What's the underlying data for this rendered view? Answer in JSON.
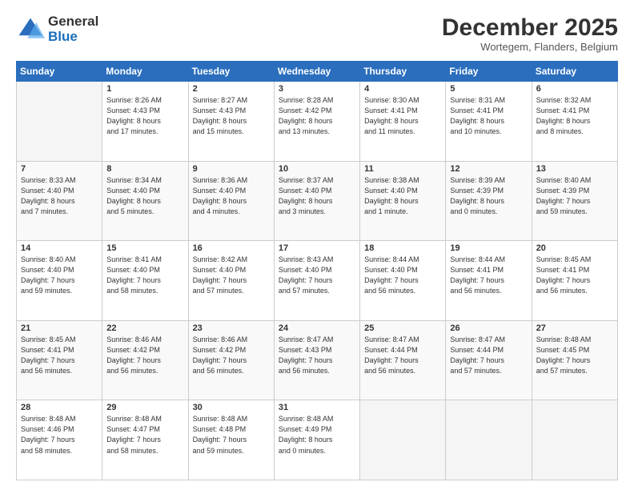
{
  "logo": {
    "line1": "General",
    "line2": "Blue"
  },
  "title": "December 2025",
  "subtitle": "Wortegem, Flanders, Belgium",
  "weekdays": [
    "Sunday",
    "Monday",
    "Tuesday",
    "Wednesday",
    "Thursday",
    "Friday",
    "Saturday"
  ],
  "weeks": [
    [
      {
        "day": "",
        "info": ""
      },
      {
        "day": "1",
        "info": "Sunrise: 8:26 AM\nSunset: 4:43 PM\nDaylight: 8 hours\nand 17 minutes."
      },
      {
        "day": "2",
        "info": "Sunrise: 8:27 AM\nSunset: 4:43 PM\nDaylight: 8 hours\nand 15 minutes."
      },
      {
        "day": "3",
        "info": "Sunrise: 8:28 AM\nSunset: 4:42 PM\nDaylight: 8 hours\nand 13 minutes."
      },
      {
        "day": "4",
        "info": "Sunrise: 8:30 AM\nSunset: 4:41 PM\nDaylight: 8 hours\nand 11 minutes."
      },
      {
        "day": "5",
        "info": "Sunrise: 8:31 AM\nSunset: 4:41 PM\nDaylight: 8 hours\nand 10 minutes."
      },
      {
        "day": "6",
        "info": "Sunrise: 8:32 AM\nSunset: 4:41 PM\nDaylight: 8 hours\nand 8 minutes."
      }
    ],
    [
      {
        "day": "7",
        "info": "Sunrise: 8:33 AM\nSunset: 4:40 PM\nDaylight: 8 hours\nand 7 minutes."
      },
      {
        "day": "8",
        "info": "Sunrise: 8:34 AM\nSunset: 4:40 PM\nDaylight: 8 hours\nand 5 minutes."
      },
      {
        "day": "9",
        "info": "Sunrise: 8:36 AM\nSunset: 4:40 PM\nDaylight: 8 hours\nand 4 minutes."
      },
      {
        "day": "10",
        "info": "Sunrise: 8:37 AM\nSunset: 4:40 PM\nDaylight: 8 hours\nand 3 minutes."
      },
      {
        "day": "11",
        "info": "Sunrise: 8:38 AM\nSunset: 4:40 PM\nDaylight: 8 hours\nand 1 minute."
      },
      {
        "day": "12",
        "info": "Sunrise: 8:39 AM\nSunset: 4:39 PM\nDaylight: 8 hours\nand 0 minutes."
      },
      {
        "day": "13",
        "info": "Sunrise: 8:40 AM\nSunset: 4:39 PM\nDaylight: 7 hours\nand 59 minutes."
      }
    ],
    [
      {
        "day": "14",
        "info": "Sunrise: 8:40 AM\nSunset: 4:40 PM\nDaylight: 7 hours\nand 59 minutes."
      },
      {
        "day": "15",
        "info": "Sunrise: 8:41 AM\nSunset: 4:40 PM\nDaylight: 7 hours\nand 58 minutes."
      },
      {
        "day": "16",
        "info": "Sunrise: 8:42 AM\nSunset: 4:40 PM\nDaylight: 7 hours\nand 57 minutes."
      },
      {
        "day": "17",
        "info": "Sunrise: 8:43 AM\nSunset: 4:40 PM\nDaylight: 7 hours\nand 57 minutes."
      },
      {
        "day": "18",
        "info": "Sunrise: 8:44 AM\nSunset: 4:40 PM\nDaylight: 7 hours\nand 56 minutes."
      },
      {
        "day": "19",
        "info": "Sunrise: 8:44 AM\nSunset: 4:41 PM\nDaylight: 7 hours\nand 56 minutes."
      },
      {
        "day": "20",
        "info": "Sunrise: 8:45 AM\nSunset: 4:41 PM\nDaylight: 7 hours\nand 56 minutes."
      }
    ],
    [
      {
        "day": "21",
        "info": "Sunrise: 8:45 AM\nSunset: 4:41 PM\nDaylight: 7 hours\nand 56 minutes."
      },
      {
        "day": "22",
        "info": "Sunrise: 8:46 AM\nSunset: 4:42 PM\nDaylight: 7 hours\nand 56 minutes."
      },
      {
        "day": "23",
        "info": "Sunrise: 8:46 AM\nSunset: 4:42 PM\nDaylight: 7 hours\nand 56 minutes."
      },
      {
        "day": "24",
        "info": "Sunrise: 8:47 AM\nSunset: 4:43 PM\nDaylight: 7 hours\nand 56 minutes."
      },
      {
        "day": "25",
        "info": "Sunrise: 8:47 AM\nSunset: 4:44 PM\nDaylight: 7 hours\nand 56 minutes."
      },
      {
        "day": "26",
        "info": "Sunrise: 8:47 AM\nSunset: 4:44 PM\nDaylight: 7 hours\nand 57 minutes."
      },
      {
        "day": "27",
        "info": "Sunrise: 8:48 AM\nSunset: 4:45 PM\nDaylight: 7 hours\nand 57 minutes."
      }
    ],
    [
      {
        "day": "28",
        "info": "Sunrise: 8:48 AM\nSunset: 4:46 PM\nDaylight: 7 hours\nand 58 minutes."
      },
      {
        "day": "29",
        "info": "Sunrise: 8:48 AM\nSunset: 4:47 PM\nDaylight: 7 hours\nand 58 minutes."
      },
      {
        "day": "30",
        "info": "Sunrise: 8:48 AM\nSunset: 4:48 PM\nDaylight: 7 hours\nand 59 minutes."
      },
      {
        "day": "31",
        "info": "Sunrise: 8:48 AM\nSunset: 4:49 PM\nDaylight: 8 hours\nand 0 minutes."
      },
      {
        "day": "",
        "info": ""
      },
      {
        "day": "",
        "info": ""
      },
      {
        "day": "",
        "info": ""
      }
    ]
  ]
}
